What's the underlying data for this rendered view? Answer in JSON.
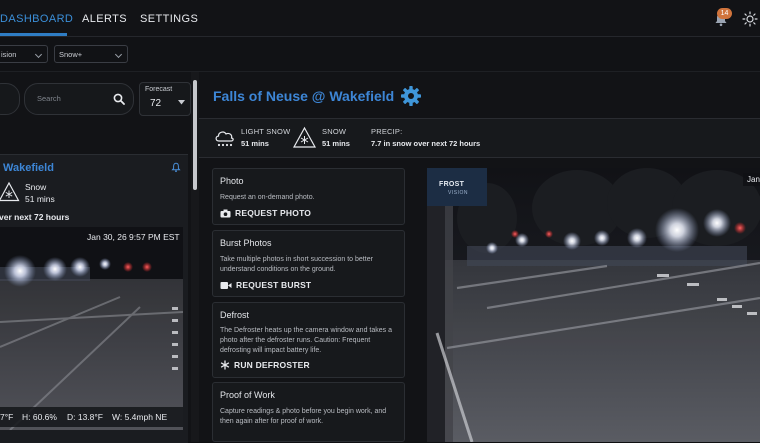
{
  "nav": {
    "tabs": [
      {
        "label": "DASHBOARD"
      },
      {
        "label": "ALERTS"
      },
      {
        "label": "SETTINGS"
      }
    ],
    "notification_count": "14"
  },
  "filters": {
    "vision_select": "ision",
    "snow_select": "Snow+"
  },
  "sidebar": {
    "search_placeholder": "Search",
    "forecast_label": "Forecast",
    "forecast_value": "72",
    "card": {
      "title": "Wakefield",
      "condition": "Snow",
      "duration": "51 mins",
      "precip": "ver next 72 hours",
      "timestamp": "Jan 30, 26 9:57 PM EST",
      "readings": {
        "temp": "7°F",
        "humidity": "H: 60.6%",
        "dewpoint": "D: 13.8°F",
        "wind": "W: 5.4mph NE"
      }
    }
  },
  "main": {
    "title": "Falls of Neuse @ Wakefield",
    "weather": {
      "light_snow_label": "LIGHT SNOW",
      "light_snow_duration": "51 mins",
      "snow_label": "SNOW",
      "snow_duration": "51 mins",
      "precip_label": "PRECIP:",
      "precip_value": "7.7 in snow over next 72 hours"
    },
    "actions": [
      {
        "title": "Photo",
        "desc": "Request an on-demand photo.",
        "button": "REQUEST PHOTO"
      },
      {
        "title": "Burst Photos",
        "desc": "Take multiple photos in short succession to better understand conditions on the ground.",
        "button": "REQUEST BURST"
      },
      {
        "title": "Defrost",
        "desc": "The Defroster heats up the camera window and takes a photo after the defroster runs. Caution: Frequent defrosting will impact battery life.",
        "button": "RUN DEFROSTER"
      },
      {
        "title": "Proof of Work",
        "desc": "Capture readings & photo before you begin work, and then again after for proof of work."
      }
    ],
    "camera": {
      "brand_line1": "FROST",
      "brand_line2": "VISION",
      "date_stub": "Jan"
    }
  },
  "colors": {
    "accent": "#3d86d6",
    "badge": "#d0743c",
    "background": "#0e0f11"
  }
}
